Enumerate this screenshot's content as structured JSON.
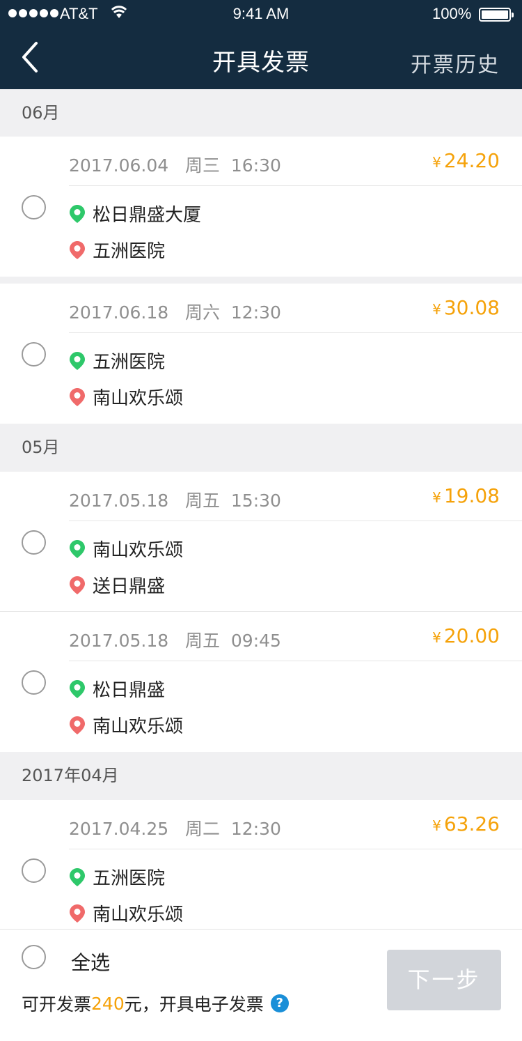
{
  "status_bar": {
    "carrier": "AT&T",
    "time": "9:41 AM",
    "battery": "100%"
  },
  "nav": {
    "title": "开具发票",
    "history": "开票历史"
  },
  "months": [
    "06月",
    "05月",
    "2017年04月"
  ],
  "trips": [
    {
      "date": "2017.06.04",
      "weekday": "周三",
      "time": "16:30",
      "currency": "¥",
      "amount": "24.20",
      "from": "松日鼎盛大厦",
      "to": "五洲医院"
    },
    {
      "date": "2017.06.18",
      "weekday": "周六",
      "time": "12:30",
      "currency": "¥",
      "amount": "30.08",
      "from": "五洲医院",
      "to": "南山欢乐颂"
    },
    {
      "date": "2017.05.18",
      "weekday": "周五",
      "time": "15:30",
      "currency": "¥",
      "amount": "19.08",
      "from": "南山欢乐颂",
      "to": "送日鼎盛"
    },
    {
      "date": "2017.05.18",
      "weekday": "周五",
      "time": "09:45",
      "currency": "¥",
      "amount": "20.00",
      "from": "松日鼎盛",
      "to": "南山欢乐颂"
    },
    {
      "date": "2017.04.25",
      "weekday": "周二",
      "time": "12:30",
      "currency": "¥",
      "amount": "63.26",
      "from": "五洲医院",
      "to": "南山欢乐颂"
    }
  ],
  "footer": {
    "select_all": "全选",
    "note_prefix": "可开发票",
    "note_amount": "240",
    "note_suffix": "元，开具电子发票",
    "help": "?",
    "next": "下一步"
  },
  "colors": {
    "nav_bg": "#142c40",
    "accent": "#f5a20a",
    "origin": "#2ec86a",
    "destination": "#f06a6a",
    "help": "#1a8fd8"
  }
}
